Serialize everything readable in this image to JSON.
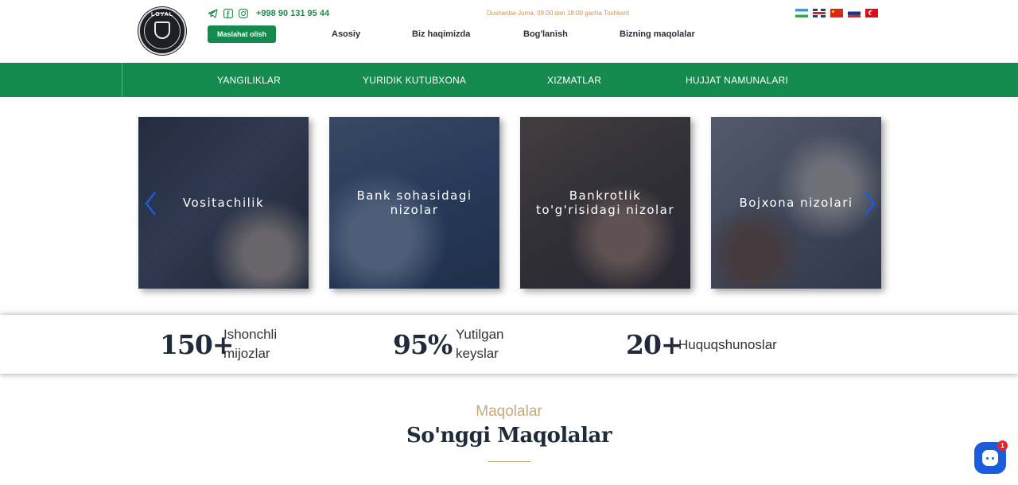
{
  "header": {
    "logo_text": "LOYAL",
    "phone": "+998 90 131 95 44",
    "hours": "Dushanba-Juma, 09:00 dan 18:00 gacha Toshkent",
    "cta_label": "Maslahat olish",
    "nav": [
      "Asosiy",
      "Biz haqimizda",
      "Bog'lanish",
      "Bizning maqolalar"
    ],
    "social_icons": [
      "telegram-icon",
      "facebook-icon",
      "instagram-icon"
    ],
    "languages": [
      "uz",
      "en",
      "cn",
      "ru",
      "tr"
    ]
  },
  "main_nav": [
    "YANGILIKLAR",
    "YURIDIK KUTUBXONA",
    "XIZMATLAR",
    "HUJJAT NAMUNALARI"
  ],
  "carousel": {
    "cards": [
      {
        "title": "Vositachilik"
      },
      {
        "title": "Bank sohasidagi\nnizolar"
      },
      {
        "title": "Bankrotlik\nto'g'risidagi nizolar"
      },
      {
        "title": "Bojxona nizolari"
      }
    ]
  },
  "stats": [
    {
      "number": "150+",
      "label_1": "Ishonchli",
      "label_2": "mijozlar"
    },
    {
      "number": "95%",
      "label_1": "Yutilgan",
      "label_2": "keyslar"
    },
    {
      "number": "20+",
      "label_1": "Huquqshunoslar",
      "label_2": ""
    }
  ],
  "articles": {
    "subtitle": "Maqolalar",
    "title": "So'nggi Maqolalar"
  },
  "chat": {
    "badge": "1"
  },
  "colors": {
    "primary_green": "#148a4e",
    "accent_gold": "#c8a97e",
    "navy": "#1f2b3a",
    "chat_blue": "#1a5cdb"
  }
}
